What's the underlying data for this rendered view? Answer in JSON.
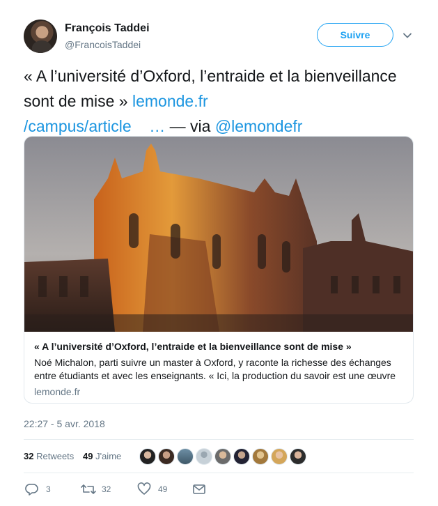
{
  "author": {
    "name": "François Taddei",
    "handle": "@FrancoisTaddei",
    "follow_label": "Suivre"
  },
  "tweet": {
    "text_prefix": "« A l’université d’Oxford, l’entraide et la bienveillance sont de mise » ",
    "link_1": "lemonde.fr",
    "link_2": "/campus/article",
    "ellipsis": "…",
    "via_text": " — via ",
    "mention": "@lemondefr"
  },
  "card": {
    "title": "« A l’université d’Oxford, l’entraide et la bienveillance sont de mise »",
    "description": "Noé Michalon, parti suivre un master à Oxford, y raconte la richesse des échanges entre étudiants et avec les enseignants. « Ici, la production du savoir est une œuvre",
    "domain": "lemonde.fr"
  },
  "timestamp": "22:27 - 5 avr. 2018",
  "stats": {
    "retweets_count": "32",
    "retweets_label": "Retweets",
    "likes_count": "49",
    "likes_label": "J'aime"
  },
  "actions": {
    "reply_count": "3",
    "retweet_count": "32",
    "like_count": "49"
  },
  "icons": {
    "caret": "chevron-down-icon",
    "reply": "reply-icon",
    "retweet": "retweet-icon",
    "like": "heart-icon",
    "dm": "direct-message-icon"
  },
  "colors": {
    "accent": "#1da1f2",
    "link": "#1b95e0",
    "secondary_text": "#657786"
  }
}
